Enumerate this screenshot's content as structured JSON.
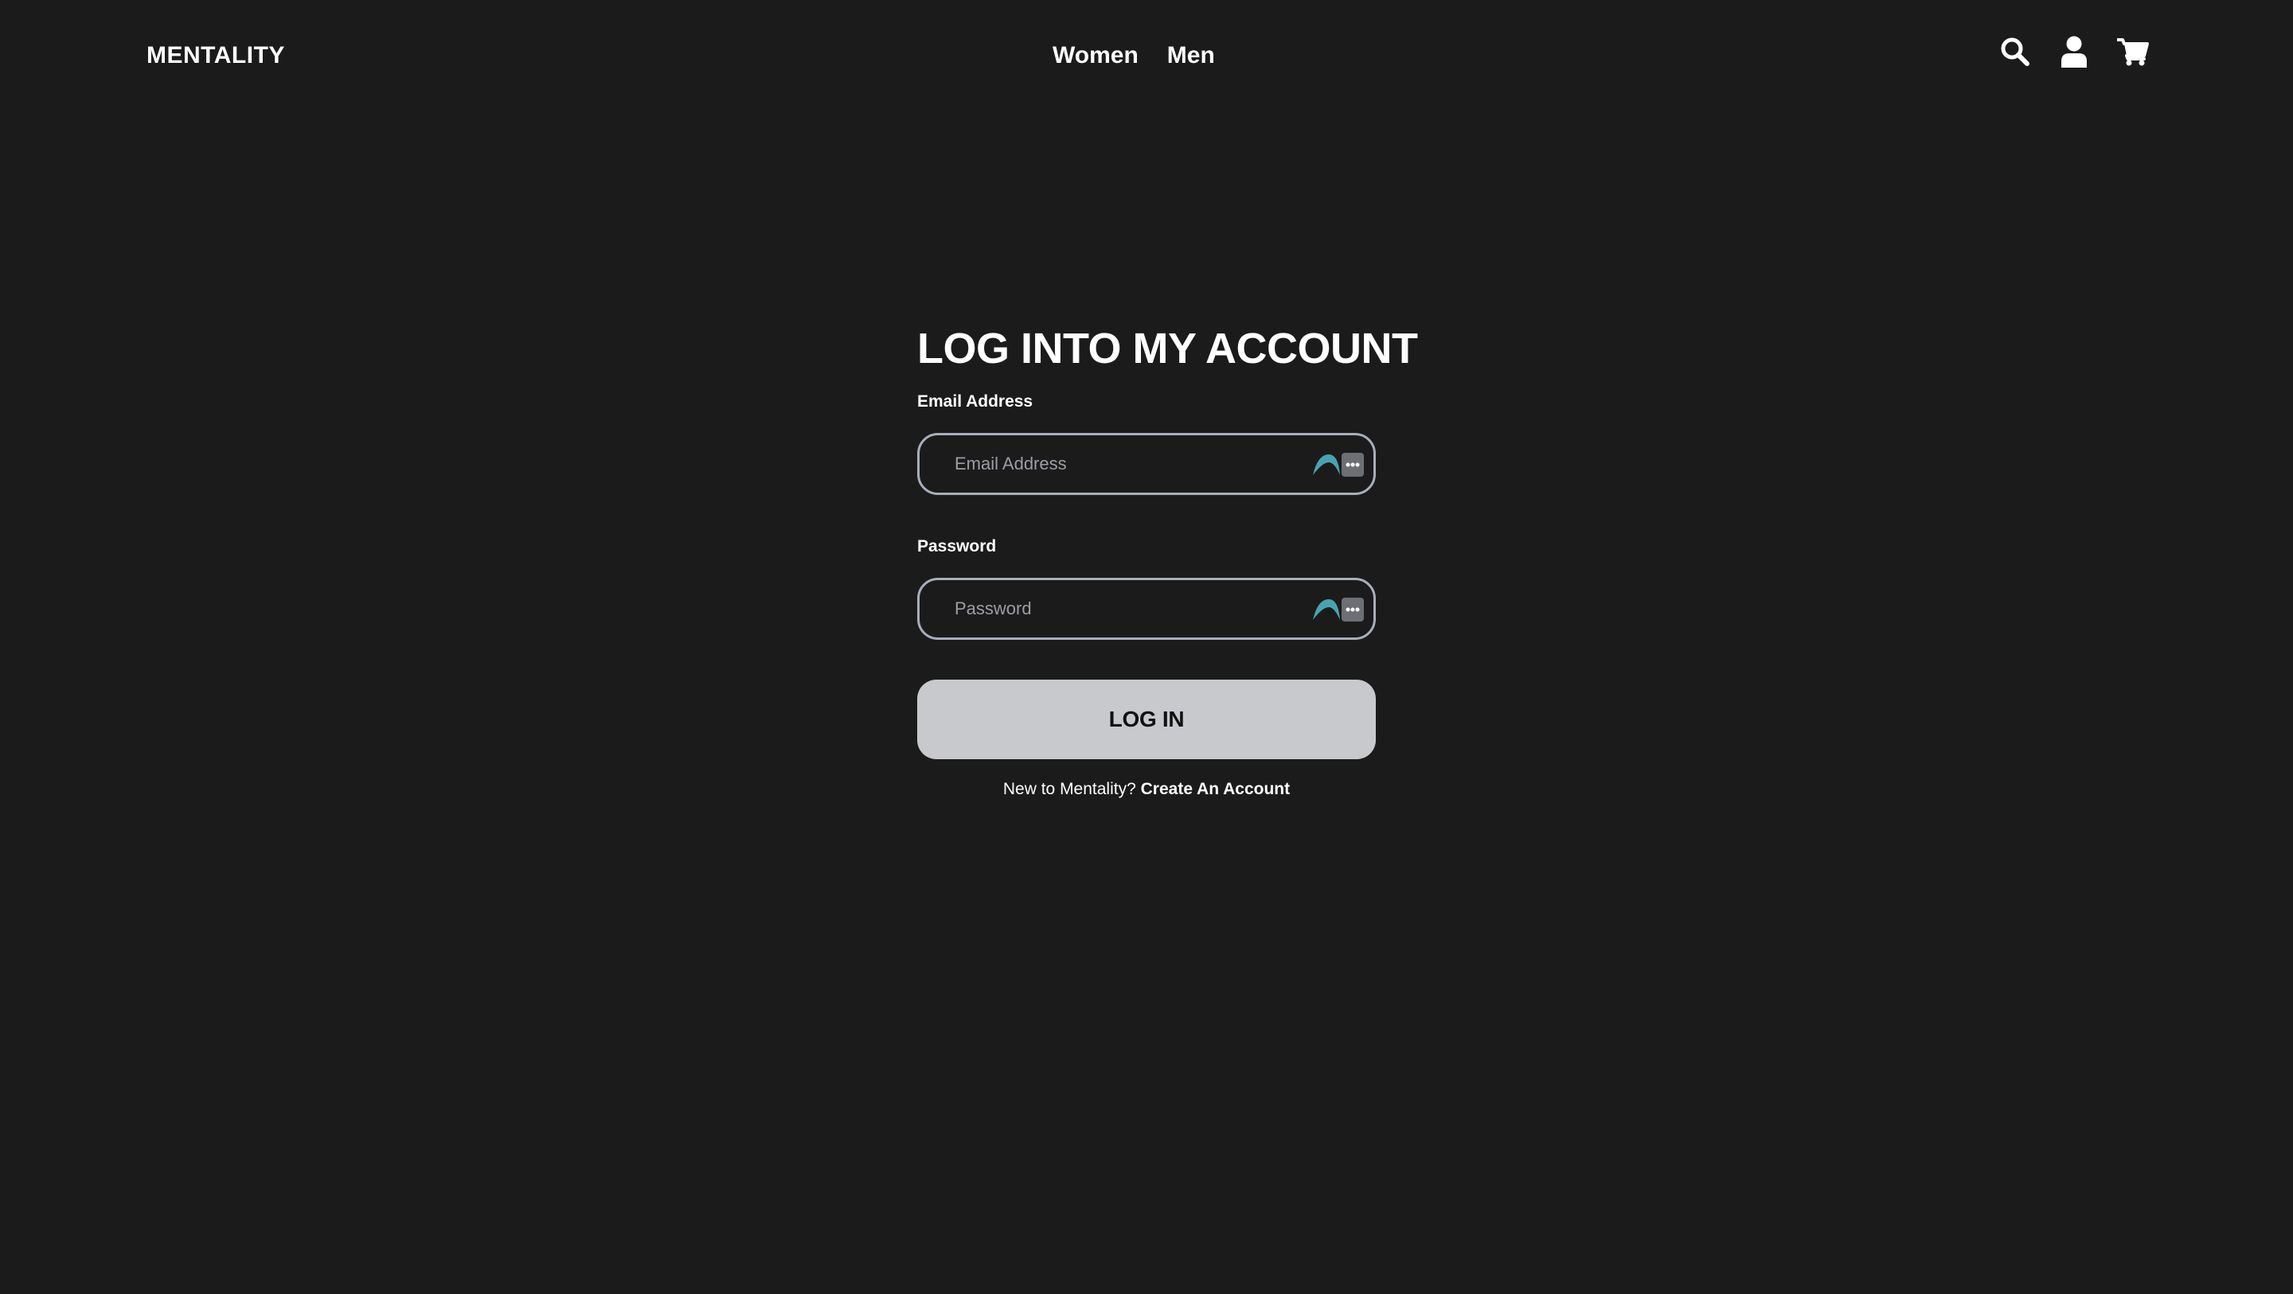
{
  "header": {
    "logo": "MENTALITY",
    "nav": [
      {
        "label": "Women"
      },
      {
        "label": "Men"
      }
    ],
    "icons": [
      "search-icon",
      "user-icon",
      "cart-icon"
    ]
  },
  "form": {
    "title": "LOG INTO MY ACCOUNT",
    "email": {
      "label": "Email Address",
      "placeholder": "Email Address",
      "value": ""
    },
    "password": {
      "label": "Password",
      "placeholder": "Password",
      "value": ""
    },
    "submit_label": "LOG IN",
    "signup_prompt": "New to Mentality?",
    "signup_link": "Create An Account"
  },
  "colors": {
    "background": "#1b1b1b",
    "text": "#ffffff",
    "input_border": "#a9aebc",
    "button_bg": "#c7c9cc",
    "button_text": "#111111",
    "badge_accent": "#4aa3b0"
  }
}
